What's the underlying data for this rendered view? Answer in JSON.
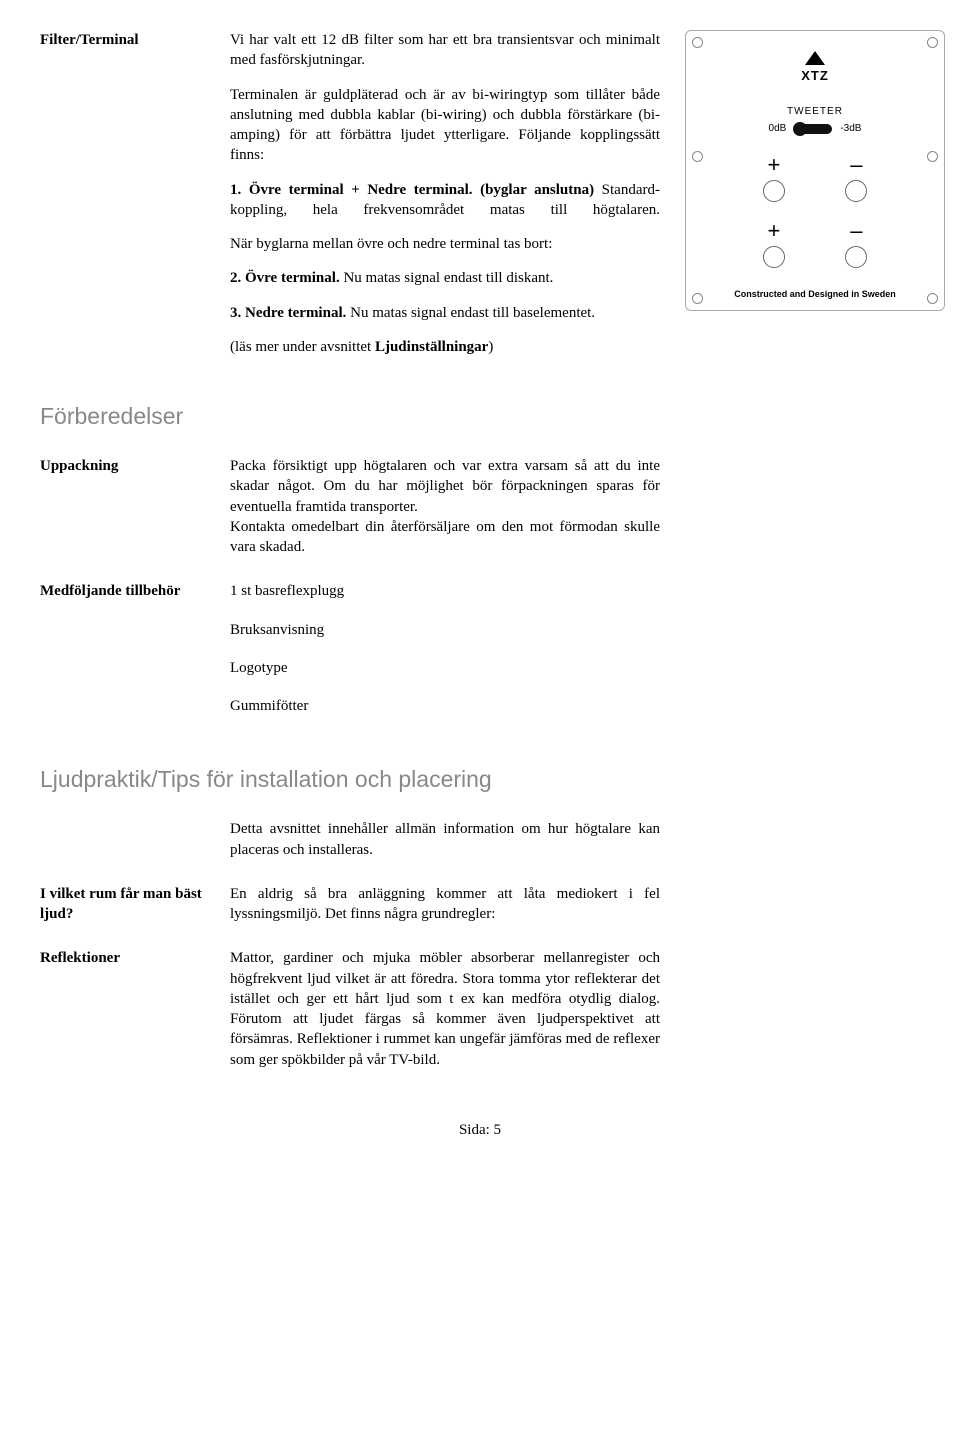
{
  "filter": {
    "label": "Filter/Terminal",
    "p1": "Vi har valt ett 12 dB filter som har ett bra transientsvar och minimalt med fasförskjutningar.",
    "p2": "Terminalen är guldpläterad och är av bi-wiringtyp som tillåter både anslutning med dubbla kablar (bi-wiring) och dubbla förstärkare (bi-amping) för att förbättra ljudet ytterligare. Följande kopplingssätt finns:",
    "p3a": "1. Övre terminal + Nedre terminal. (byglar anslutna)",
    "p3b": " Standard-koppling, hela frekvensområdet matas till högtalaren.",
    "p4": "När byglarna mellan övre och nedre terminal tas bort:",
    "p5a": "2. Övre terminal.",
    "p5b": " Nu matas signal endast till diskant.",
    "p6a": "3. Nedre terminal.",
    "p6b": " Nu matas signal endast till baselementet.",
    "p7a": "(läs mer under avsnittet ",
    "p7b": "Ljudinställningar",
    "p7c": ")"
  },
  "panel": {
    "logo": "XTZ",
    "tweeter": "TWEETER",
    "db0": "0dB",
    "db3": "-3dB",
    "plus": "+",
    "minus": "–",
    "footer": "Constructed and Designed in Sweden"
  },
  "prep_heading": "Förberedelser",
  "unpack": {
    "label": "Uppackning",
    "p1": "Packa försiktigt upp högtalaren och var extra varsam så att du inte skadar något. Om du har möjlighet bör förpackningen sparas för eventuella framtida transporter.",
    "p2": "Kontakta omedelbart din återförsäljare om den mot förmodan skulle vara skadad."
  },
  "accessories": {
    "label": "Medföljande tillbehör",
    "items": [
      "1 st basreflexplugg",
      "Bruksanvisning",
      "Logotype",
      "Gummifötter"
    ]
  },
  "tips_heading": "Ljudpraktik/Tips för installation och placering",
  "tips_intro": "Detta avsnittet innehåller allmän information om hur högtalare kan placeras och installeras.",
  "room": {
    "label": "I vilket rum får man bäst ljud?",
    "body": "En aldrig så bra anläggning kommer att låta mediokert i fel lyssningsmiljö. Det finns några grundregler:"
  },
  "refl": {
    "label": "Reflektioner",
    "body": "Mattor, gardiner och mjuka möbler absorberar mellanregister och högfrekvent ljud vilket är att föredra. Stora tomma ytor reflekterar det istället och ger ett hårt ljud som t ex kan medföra otydlig dialog. Förutom att ljudet färgas så kommer även ljudperspektivet att försämras. Reflektioner i rummet kan ungefär jämföras med de reflexer som ger spökbilder på vår TV-bild."
  },
  "page_footer": "Sida: 5"
}
